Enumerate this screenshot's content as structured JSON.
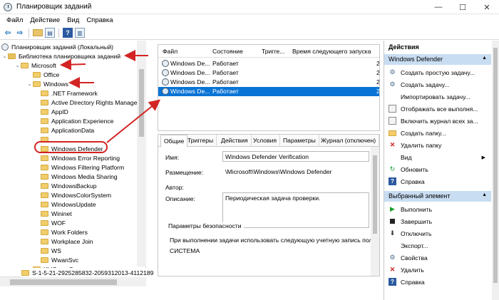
{
  "window": {
    "title": "Планировщик заданий",
    "controls": [
      "—",
      "☐",
      "✕"
    ]
  },
  "menu": [
    "Файл",
    "Действие",
    "Вид",
    "Справка"
  ],
  "tree": {
    "items": [
      {
        "label": "Планировщик заданий (Локальный)",
        "level": 0,
        "expander": "",
        "icon": "scheduler-icon"
      },
      {
        "label": "Библиотека планировщика заданий",
        "level": 1,
        "expander": "⌄",
        "icon": "library-folder-icon"
      },
      {
        "label": "Microsoft",
        "level": 2,
        "expander": "⌄",
        "icon": "folder-icon"
      },
      {
        "label": "Office",
        "level": 3,
        "expander": "",
        "icon": "folder-icon"
      },
      {
        "label": "Windows",
        "level": 3,
        "expander": "⌄",
        "icon": "folder-icon"
      },
      {
        "label": ".NET Framework",
        "level": 4,
        "expander": "",
        "icon": "folder-icon"
      },
      {
        "label": "Active Directory Rights Managemen",
        "level": 4,
        "expander": "",
        "icon": "folder-icon"
      },
      {
        "label": "AppID",
        "level": 4,
        "expander": "",
        "icon": "folder-icon"
      },
      {
        "label": "Application Experience",
        "level": 4,
        "expander": "",
        "icon": "folder-icon"
      },
      {
        "label": "ApplicationData",
        "level": 4,
        "expander": "",
        "icon": "folder-icon"
      },
      {
        "label": "",
        "level": 4,
        "expander": "",
        "icon": "folder-icon"
      },
      {
        "label": "Windows Defender",
        "level": 4,
        "expander": "",
        "icon": "folder-icon"
      },
      {
        "label": "Windows Error Reporting",
        "level": 4,
        "expander": "",
        "icon": "folder-icon"
      },
      {
        "label": "Windows Filtering Platform",
        "level": 4,
        "expander": "",
        "icon": "folder-icon"
      },
      {
        "label": "Windows Media Sharing",
        "level": 4,
        "expander": "",
        "icon": "folder-icon"
      },
      {
        "label": "WindowsBackup",
        "level": 4,
        "expander": "",
        "icon": "folder-icon"
      },
      {
        "label": "WindowsColorSystem",
        "level": 4,
        "expander": "",
        "icon": "folder-icon"
      },
      {
        "label": "WindowsUpdate",
        "level": 4,
        "expander": "",
        "icon": "folder-icon"
      },
      {
        "label": "Wininet",
        "level": 4,
        "expander": "",
        "icon": "folder-icon"
      },
      {
        "label": "WOF",
        "level": 4,
        "expander": "",
        "icon": "folder-icon"
      },
      {
        "label": "Work Folders",
        "level": 4,
        "expander": "",
        "icon": "folder-icon"
      },
      {
        "label": "Workplace Join",
        "level": 4,
        "expander": "",
        "icon": "folder-icon"
      },
      {
        "label": "WS",
        "level": 4,
        "expander": "",
        "icon": "folder-icon"
      },
      {
        "label": "WwanSvc",
        "level": 4,
        "expander": "",
        "icon": "folder-icon"
      },
      {
        "label": "XblGameSave",
        "level": 3,
        "expander": "",
        "icon": "folder-icon"
      },
      {
        "label": "S-1-5-21-2925285832-2059312013-4112189",
        "level": 2,
        "expander": "",
        "icon": "folder-icon"
      }
    ]
  },
  "task_list": {
    "columns": [
      "Файл",
      "Состояние",
      "Тригге...",
      "Время следующего запуска"
    ],
    "rows": [
      {
        "name": "Windows De...",
        "status": "Работает",
        "trigger": "",
        "next": "",
        "extra": "2",
        "selected": false
      },
      {
        "name": "Windows De...",
        "status": "Работает",
        "trigger": "",
        "next": "",
        "extra": "2",
        "selected": false
      },
      {
        "name": "Windows De...",
        "status": "Работает",
        "trigger": "",
        "next": "",
        "extra": "2",
        "selected": false
      },
      {
        "name": "Windows De...",
        "status": "Работает",
        "trigger": "",
        "next": "",
        "extra": "2",
        "selected": true
      }
    ]
  },
  "properties": {
    "tabs": [
      "Общие",
      "Триггеры",
      "Действия",
      "Условия",
      "Параметры",
      "Журнал (отключен)"
    ],
    "name_label": "Имя:",
    "name_value": "Windows Defender Verification",
    "location_label": "Размещение:",
    "location_value": "\\Microsoft\\Windows\\Windows Defender",
    "author_label": "Автор:",
    "author_value": "",
    "description_label": "Описание:",
    "description_value": "Периодическая задача проверки.",
    "security_group": "Параметры безопасности",
    "security_text": "При выполнении задачи использовать следующую учетную запись пол",
    "security_account": "СИСТЕМА"
  },
  "actions": {
    "header": "Действия",
    "section1_title": "Windows Defender",
    "section1_items": [
      {
        "label": "Создать простую задачу...",
        "icon": "create-basic-task-icon"
      },
      {
        "label": "Создать задачу...",
        "icon": "create-task-icon"
      },
      {
        "label": "Импортировать задачу...",
        "icon": ""
      },
      {
        "label": "Отображать все выполня...",
        "icon": "running-tasks-icon"
      },
      {
        "label": "Включить журнал всех за...",
        "icon": "history-icon"
      },
      {
        "label": "Создать папку...",
        "icon": "new-folder-icon"
      },
      {
        "label": "Удалить папку",
        "icon": "delete-folder-icon"
      },
      {
        "label": "Вид",
        "icon": ""
      },
      {
        "label": "Обновить",
        "icon": "refresh-icon"
      },
      {
        "label": "Справка",
        "icon": "help-icon"
      }
    ],
    "section2_title": "Выбранный элемент",
    "section2_items": [
      {
        "label": "Выполнить",
        "icon": "run-icon"
      },
      {
        "label": "Завершить",
        "icon": "end-icon"
      },
      {
        "label": "Отключить",
        "icon": "disable-icon"
      },
      {
        "label": "Экспорт...",
        "icon": ""
      },
      {
        "label": "Свойства",
        "icon": "properties-icon"
      },
      {
        "label": "Удалить",
        "icon": "delete-icon"
      },
      {
        "label": "Справка",
        "icon": "help-icon"
      }
    ]
  },
  "colors": {
    "selection": "#0a74d6",
    "section_header": "#c9ddf2",
    "annotation_red": "#d32323"
  }
}
